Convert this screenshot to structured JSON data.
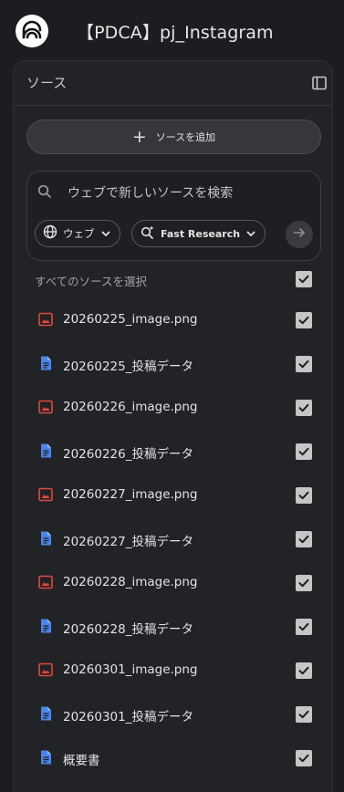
{
  "app": {
    "title": "【PDCA】pj_Instagram"
  },
  "panel": {
    "title": "ソース",
    "add_source_label": "ソースを追加",
    "search": {
      "placeholder": "ウェブで新しいソースを検索",
      "chip_web": "ウェブ",
      "chip_research": "Fast Research"
    },
    "select_all_label": "すべてのソースを選択",
    "select_all_checked": true,
    "sources": [
      {
        "name": "20260225_image.png",
        "type": "image",
        "checked": true
      },
      {
        "name": "20260225_投稿データ",
        "type": "doc",
        "checked": true
      },
      {
        "name": "20260226_image.png",
        "type": "image",
        "checked": true
      },
      {
        "name": "20260226_投稿データ",
        "type": "doc",
        "checked": true
      },
      {
        "name": "20260227_image.png",
        "type": "image",
        "checked": true
      },
      {
        "name": "20260227_投稿データ",
        "type": "doc",
        "checked": true
      },
      {
        "name": "20260228_image.png",
        "type": "image",
        "checked": true
      },
      {
        "name": "20260228_投稿データ",
        "type": "doc",
        "checked": true
      },
      {
        "name": "20260301_image.png",
        "type": "image",
        "checked": true
      },
      {
        "name": "20260301_投稿データ",
        "type": "doc",
        "checked": true
      },
      {
        "name": "概要書",
        "type": "doc",
        "checked": true
      }
    ]
  },
  "colors": {
    "background": "#1c1d21",
    "panel": "#222327",
    "image_icon": "#e2473b",
    "doc_icon": "#4a86e8",
    "checkbox": "#c4c7c5"
  },
  "icons": {
    "logo": "notebook-logo-icon",
    "panel_toggle": "sidebar-toggle-icon",
    "add": "plus-icon",
    "search": "search-icon",
    "web": "globe-icon",
    "research": "sparkle-search-icon",
    "dropdown": "chevron-down-icon",
    "submit": "arrow-right-icon",
    "image_source": "image-file-icon",
    "doc_source": "document-file-icon",
    "check": "checkmark-icon"
  }
}
